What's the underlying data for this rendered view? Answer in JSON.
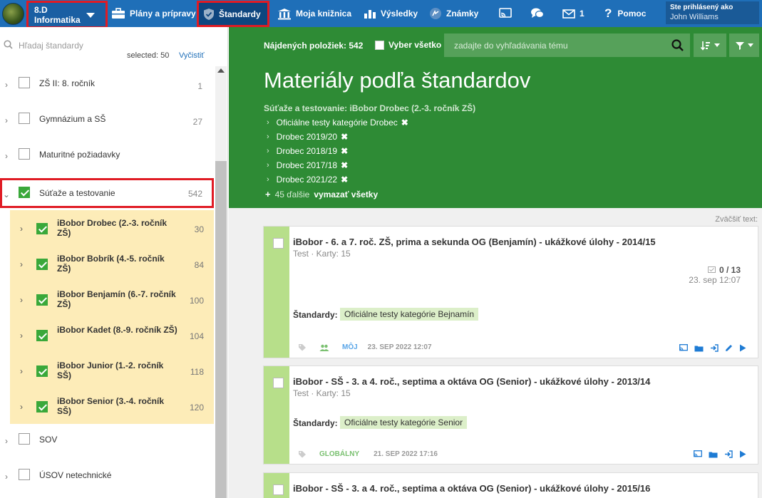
{
  "nav": {
    "class_line1": "8.D",
    "class_line2": "Informatika",
    "items": [
      {
        "label": "Plány a prípravy"
      },
      {
        "label": "Štandardy"
      },
      {
        "label": "Moja knižnica"
      },
      {
        "label": "Výsledky"
      },
      {
        "label": "Známky"
      },
      {
        "label": ""
      },
      {
        "label": ""
      },
      {
        "label": "1"
      },
      {
        "label": "Pomoc"
      }
    ],
    "user_label": "Ste prihlásený ako",
    "user_name": "John Williams",
    "active_item": "Štandardy"
  },
  "left": {
    "search_placeholder": "Hľadaj štandardy",
    "selected_text": "selected: 50",
    "clear_label": "Vyčistiť",
    "tree": [
      {
        "label": "ZŠ II: 8. ročník",
        "count": "1",
        "checked": false
      },
      {
        "label": "Gymnázium a SŠ",
        "count": "27",
        "checked": false
      },
      {
        "label": "Maturitné požiadavky",
        "count": "",
        "checked": false
      },
      {
        "label": "Súťaže a testovanie",
        "count": "542",
        "checked": true,
        "expanded": true,
        "highlighted": true
      }
    ],
    "subitems": [
      {
        "label": "iBobor Drobec (2.-3. ročník ZŠ)",
        "count": "30"
      },
      {
        "label": "iBobor Bobrík (4.-5. ročník ZŠ)",
        "count": "84"
      },
      {
        "label": "iBobor Benjamín (6.-7. ročník ZŠ)",
        "count": "100"
      },
      {
        "label": "iBobor Kadet (8.-9. ročník ZŠ)",
        "count": "104"
      },
      {
        "label": "iBobor Junior (1.-2. ročník SŠ)",
        "count": "118"
      },
      {
        "label": "iBobor Senior (3.-4. ročník SŠ)",
        "count": "120"
      }
    ],
    "tree_after": [
      {
        "label": "SOV",
        "count": "",
        "checked": false
      },
      {
        "label": "ÚSOV netechnické",
        "count": "",
        "checked": false
      }
    ]
  },
  "header": {
    "found_text": "Nájdených položiek: 542",
    "select_all_label": "Vyber všetko",
    "search_placeholder": "zadajte do vyhľadávania tému",
    "title": "Materiály podľa štandardov",
    "breadcrumb": "Súťaže a testovanie: iBobor Drobec (2.-3. ročník ZŠ)",
    "filters": [
      "Oficiálne testy kategórie Drobec",
      "Drobec 2019/20",
      "Drobec 2018/19",
      "Drobec 2017/18",
      "Drobec 2021/22"
    ],
    "more_text": "45 ďalšie",
    "clear_all_label": "vymazať všetky"
  },
  "content": {
    "zoom_label": "Zväčšiť text:",
    "standards_label": "Štandardy:",
    "cards": [
      {
        "title": "iBobor - 6. a 7. roč. ZŠ, prima a sekunda OG (Benjamín) - ukážkové úlohy - 2014/15",
        "subtitle": "Test · Karty: 15",
        "score": "0 / 13",
        "date_right": "23. sep 12:07",
        "standard": "Oficiálne testy kategórie Bejnamín",
        "meta_owner": "MÔJ",
        "meta_date": "23. SEP 2022 12:07"
      },
      {
        "title": "iBobor - SŠ - 3. a 4. roč., septima a oktáva OG (Senior) - ukážkové úlohy - 2013/14",
        "subtitle": "Test · Karty: 15",
        "standard": "Oficiálne testy kategórie Senior",
        "meta_scope": "GLOBÁLNY",
        "meta_date": "21. SEP 2022 17:16"
      },
      {
        "title": "iBobor - SŠ - 3. a 4. roč., septima a oktáva OG (Senior) - ukážkové úlohy - 2015/16"
      }
    ]
  },
  "colors": {
    "nav_bg": "#1f6fb8",
    "highlight_red": "#e01b24",
    "header_green": "#2e8b35",
    "checkbox_green": "#3aa83a",
    "subitem_bg": "#fdecb8",
    "card_stripe": "#b7df8a",
    "standard_tag_bg": "#dcefc9"
  }
}
